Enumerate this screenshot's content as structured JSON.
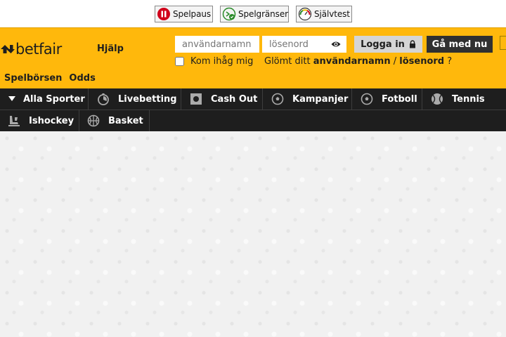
{
  "regulatory": {
    "pause": "Spelpaus",
    "limits": "Spelgränser",
    "selftest": "Självtest"
  },
  "header": {
    "logo_text": "betfair",
    "help": "Hjälp",
    "username_placeholder": "användarnamn",
    "password_placeholder": "lösenord",
    "login": "Logga in",
    "join": "Gå med nu",
    "remember_me": "Kom ihåg mig",
    "forgot_prefix": "Glömt ditt",
    "forgot_username": "användarnamn",
    "forgot_sep": "/",
    "forgot_password": "lösenord",
    "forgot_suffix": "?",
    "subnav": [
      "Spelbörsen",
      "Odds"
    ]
  },
  "nav": {
    "items": [
      {
        "label": "Alla Sporter",
        "icon": "caret-down-icon"
      },
      {
        "label": "Livebetting",
        "icon": "stopwatch-icon"
      },
      {
        "label": "Cash Out",
        "icon": "cash-out-icon"
      },
      {
        "label": "Kampanjer",
        "icon": "football-icon"
      },
      {
        "label": "Fotboll",
        "icon": "football-icon"
      },
      {
        "label": "Tennis",
        "icon": "tennis-ball-icon"
      },
      {
        "label": "Ishockey",
        "icon": "ice-hockey-icon"
      },
      {
        "label": "Basket",
        "icon": "basketball-icon"
      }
    ]
  },
  "colors": {
    "brand_yellow": "#ffb80c",
    "nav_dark": "#1e1e1e",
    "join_button": "#303030",
    "login_button": "#d5d5d5"
  }
}
